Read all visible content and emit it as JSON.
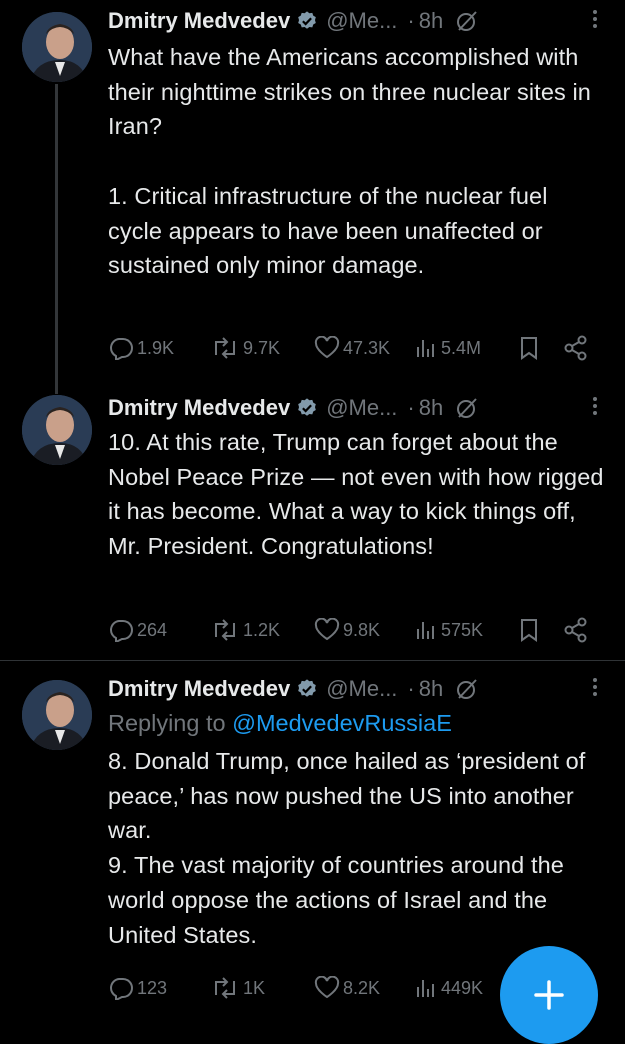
{
  "author": {
    "name": "Dmitry Medvedev",
    "handle": "@Me...",
    "dot": "·",
    "time": "8h"
  },
  "colors": {
    "background": "#000000",
    "text": "#e7e9ea",
    "muted": "#71767b",
    "accent": "#1d9bf0",
    "verified": "#829aab"
  },
  "tweets": [
    {
      "text": "What have the Americans accomplished with their nighttime strikes on three nuclear sites in Iran?\n\n1. Critical infrastructure of the nuclear fuel cycle appears to have been unaffected or sustained only minor damage.",
      "replies": "1.9K",
      "reposts": "9.7K",
      "likes": "47.3K",
      "views": "5.4M"
    },
    {
      "text": "10. At this rate, Trump can forget about the Nobel Peace Prize — not even with how rigged it has become. What a way to kick things off, Mr. President. Congratulations!",
      "replies": "264",
      "reposts": "1.2K",
      "likes": "9.8K",
      "views": "575K"
    },
    {
      "replying_prefix": "Replying to ",
      "replying_handle": "@MedvedevRussiaE",
      "text": "8. Donald Trump, once hailed as ‘president of peace,’ has now pushed the US into another war.\n9. The vast majority of countries around the world oppose the actions of Israel and the United States.",
      "replies": "123",
      "reposts": "1K",
      "likes": "8.2K",
      "views": "449K"
    }
  ],
  "icons": {
    "reply": "reply-icon",
    "repost": "repost-icon",
    "like": "heart-icon",
    "views": "views-icon",
    "bookmark": "bookmark-icon",
    "share": "share-icon",
    "grok": "grok-icon",
    "more": "more-icon",
    "compose": "plus-icon"
  }
}
